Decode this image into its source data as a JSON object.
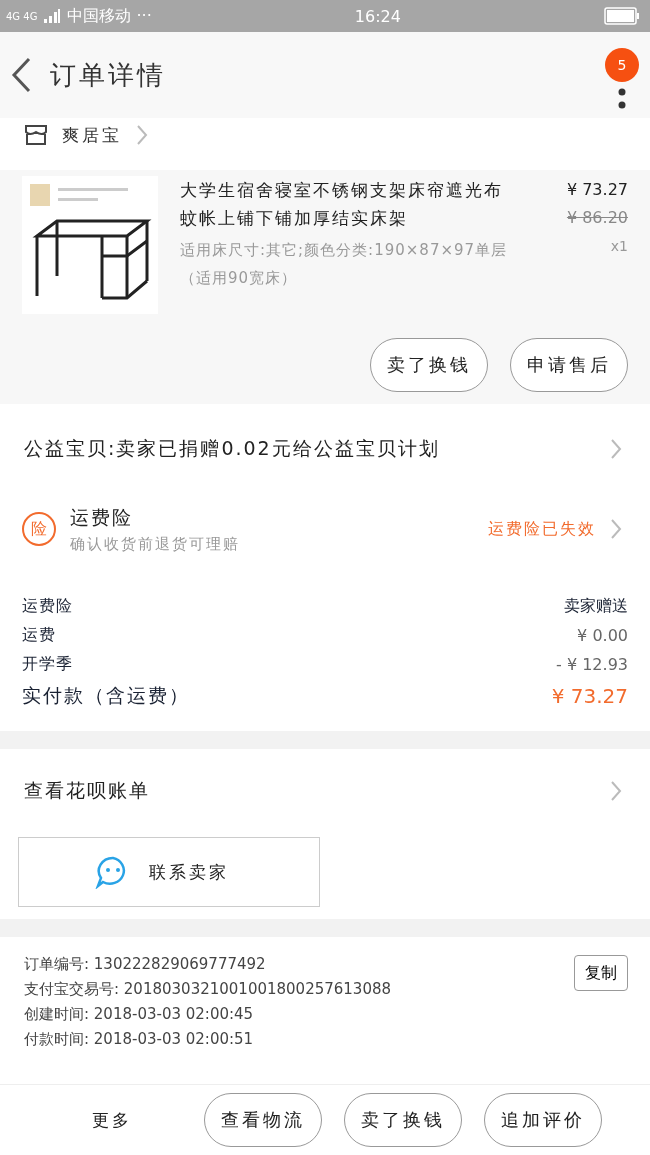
{
  "status_bar": {
    "network": "4G 4G",
    "carrier": "中国移动 ···",
    "time": "16:24"
  },
  "header": {
    "title": "订单详情",
    "badge": "5"
  },
  "shop": {
    "name": "爽居宝"
  },
  "product": {
    "title": "大学生宿舍寝室不锈钢支架床帘遮光布蚊帐上铺下铺加厚结实床架",
    "spec": "适用床尺寸:其它;颜色分类:190×87×97单层（适用90宽床）",
    "price": "¥ 73.27",
    "original_price": "¥ 86.20",
    "quantity": "x1",
    "buttons": [
      "卖了换钱",
      "申请售后"
    ]
  },
  "charity": {
    "text": "公益宝贝:卖家已捐赠0.02元给公益宝贝计划"
  },
  "insurance": {
    "icon": "险",
    "title": "运费险",
    "subtitle": "确认收货前退货可理赔",
    "status": "运费险已失效"
  },
  "costs": [
    {
      "label": "运费险",
      "value": "卖家赠送",
      "kind": "plain"
    },
    {
      "label": "运费",
      "value": "¥ 0.00",
      "kind": "muted"
    },
    {
      "label": "开学季",
      "value": "- ¥ 12.93",
      "kind": "muted"
    },
    {
      "label": "实付款（含运费）",
      "value": "¥ 73.27",
      "kind": "total"
    }
  ],
  "huabei": {
    "text": "查看花呗账单"
  },
  "contact": {
    "label": "联系卖家"
  },
  "order_info": {
    "copy": "复制",
    "lines": [
      {
        "label": "订单编号:",
        "value": "130222829069777492"
      },
      {
        "label": "支付宝交易号:",
        "value": "2018030321001001800257613088"
      },
      {
        "label": "创建时间:",
        "value": "2018-03-03 02:00:45"
      },
      {
        "label": "付款时间:",
        "value": "2018-03-03 02:00:51"
      }
    ]
  },
  "bottom_bar": {
    "more": "更多",
    "buttons": [
      "查看物流",
      "卖了换钱",
      "追加评价"
    ]
  }
}
